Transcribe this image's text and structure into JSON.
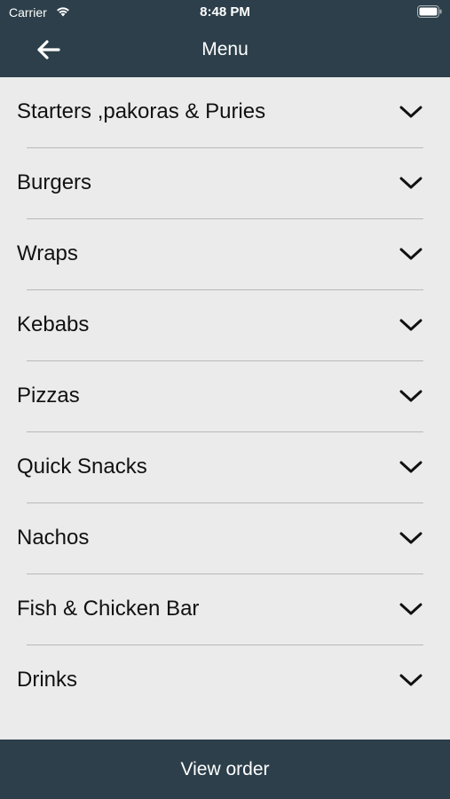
{
  "status_bar": {
    "carrier": "Carrier",
    "time": "8:48 PM",
    "wifi_icon": "wifi-icon",
    "battery_icon": "battery-icon"
  },
  "nav": {
    "title": "Menu",
    "back_icon": "arrow-left-icon"
  },
  "menu": {
    "items": [
      {
        "label": "Starters ,pakoras & Puries"
      },
      {
        "label": "Burgers"
      },
      {
        "label": "Wraps"
      },
      {
        "label": "Kebabs"
      },
      {
        "label": "Pizzas"
      },
      {
        "label": "Quick Snacks"
      },
      {
        "label": "Nachos"
      },
      {
        "label": "Fish & Chicken Bar"
      },
      {
        "label": "Drinks"
      }
    ],
    "expand_icon": "chevron-down-icon"
  },
  "footer": {
    "view_order_label": "View order"
  },
  "colors": {
    "bar_background": "#2c3f4a",
    "list_background": "#ebebeb",
    "divider": "#b9b9b9",
    "text": "#111111"
  }
}
